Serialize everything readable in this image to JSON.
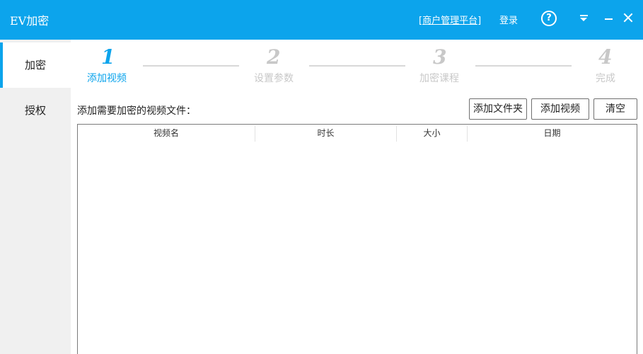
{
  "title_bar": {
    "app_title": "EV加密",
    "merchant_link": "[商户管理平台]",
    "login_link": "登录",
    "help_glyph": "?",
    "icons": [
      "help-icon",
      "menu-dropdown-icon",
      "minimize-icon",
      "close-icon"
    ],
    "accent_color": "#0ca4ec"
  },
  "sidebar": {
    "items": [
      {
        "label": "加密",
        "active": true
      },
      {
        "label": "授权",
        "active": false
      }
    ]
  },
  "steps": [
    {
      "number": "1",
      "label": "添加视频",
      "active": true
    },
    {
      "number": "2",
      "label": "设置参数",
      "active": false
    },
    {
      "number": "3",
      "label": "加密课程",
      "active": false
    },
    {
      "number": "4",
      "label": "完成",
      "active": false
    }
  ],
  "main": {
    "prompt": "添加需要加密的视频文件：",
    "buttons": {
      "add_folder": "添加文件夹",
      "add_video": "添加视频",
      "clear": "清空"
    },
    "table": {
      "columns": [
        "视频名",
        "时长",
        "大小",
        "日期"
      ],
      "rows": []
    }
  }
}
